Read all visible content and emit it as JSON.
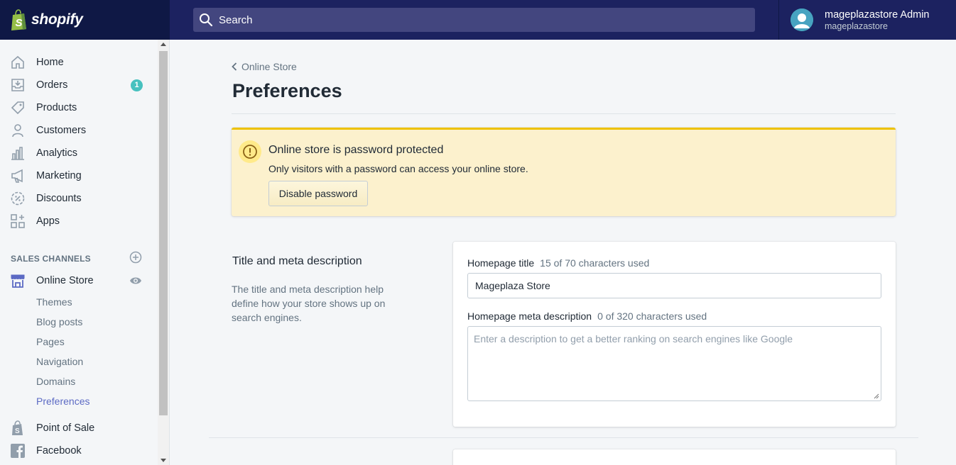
{
  "brand": {
    "name": "shopify"
  },
  "search": {
    "placeholder": "Search"
  },
  "user": {
    "name": "mageplazastore Admin",
    "store": "mageplazastore"
  },
  "sidebar": {
    "items": [
      {
        "label": "Home",
        "icon": "home-icon"
      },
      {
        "label": "Orders",
        "icon": "orders-icon",
        "badge": "1"
      },
      {
        "label": "Products",
        "icon": "tag-icon"
      },
      {
        "label": "Customers",
        "icon": "person-icon"
      },
      {
        "label": "Analytics",
        "icon": "bar-chart-icon"
      },
      {
        "label": "Marketing",
        "icon": "megaphone-icon"
      },
      {
        "label": "Discounts",
        "icon": "discount-icon"
      },
      {
        "label": "Apps",
        "icon": "apps-icon"
      }
    ],
    "sales_channels_title": "SALES CHANNELS",
    "online_store": {
      "label": "Online Store",
      "sub_items": [
        "Themes",
        "Blog posts",
        "Pages",
        "Navigation",
        "Domains",
        "Preferences"
      ],
      "active": "Preferences"
    },
    "channels": [
      {
        "label": "Point of Sale",
        "icon": "pos-icon"
      },
      {
        "label": "Facebook",
        "icon": "facebook-icon"
      }
    ]
  },
  "breadcrumb": {
    "label": "Online Store"
  },
  "page": {
    "title": "Preferences"
  },
  "banner": {
    "title": "Online store is password protected",
    "text": "Only visitors with a password can access your online store.",
    "button": "Disable password",
    "color": "#fcf1cd",
    "accent": "#eec200"
  },
  "meta_section": {
    "heading": "Title and meta description",
    "description": "The title and meta description help define how your store shows up on search engines.",
    "title_label": "Homepage title",
    "title_count": "15 of 70 characters used",
    "title_value": "Mageplaza Store",
    "desc_label": "Homepage meta description",
    "desc_count": "0 of 320 characters used",
    "desc_placeholder": "Enter a description to get a better ranking on search engines like Google"
  },
  "colors": {
    "topbar": "#1c2260",
    "accent": "#5c6ac4",
    "badge": "#47c1bf"
  }
}
